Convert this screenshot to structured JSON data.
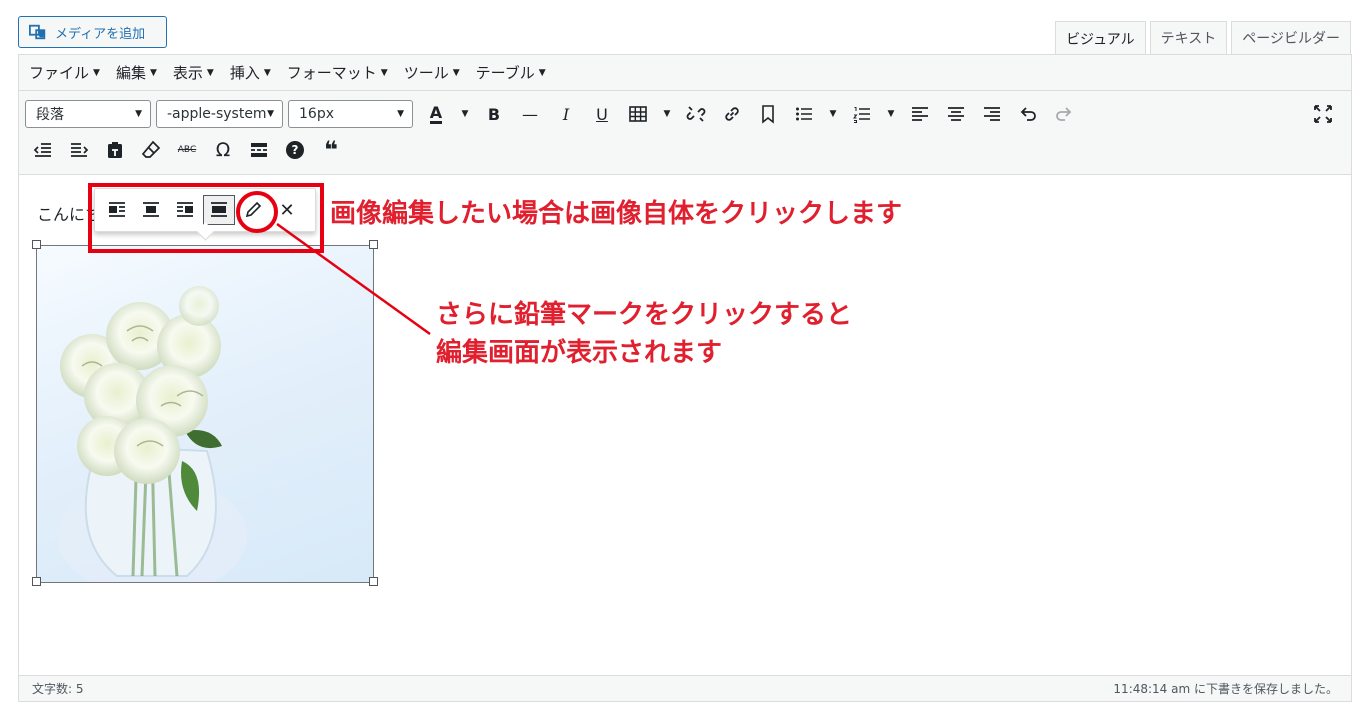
{
  "media_button": {
    "label": "メディアを追加"
  },
  "tabs": [
    {
      "label": "ビジュアル",
      "active": true
    },
    {
      "label": "テキスト",
      "active": false
    },
    {
      "label": "ページビルダー",
      "active": false
    }
  ],
  "menubar": {
    "items": [
      {
        "label": "ファイル"
      },
      {
        "label": "編集"
      },
      {
        "label": "表示"
      },
      {
        "label": "挿入"
      },
      {
        "label": "フォーマット"
      },
      {
        "label": "ツール"
      },
      {
        "label": "テーブル"
      }
    ]
  },
  "toolbar": {
    "block_format": "段落",
    "font_family": "-apple-system",
    "font_size": "16px",
    "bold": "B",
    "italic": "I",
    "underline": "U",
    "strikethrough": "ABC",
    "omega": "Ω",
    "quote": "❝",
    "help": "?"
  },
  "content": {
    "paragraph": "こんにちは"
  },
  "statusbar": {
    "word_count": "文字数: 5",
    "saved": "11:48:14 am に下書きを保存しました。"
  },
  "annotations": {
    "callout1": "画像編集したい場合は画像自体をクリックします",
    "callout2_line1": "さらに鉛筆マークをクリックすると",
    "callout2_line2": "編集画面が表示されます"
  },
  "colors": {
    "accent": "#2271b1",
    "annotation_red": "#e60012"
  }
}
